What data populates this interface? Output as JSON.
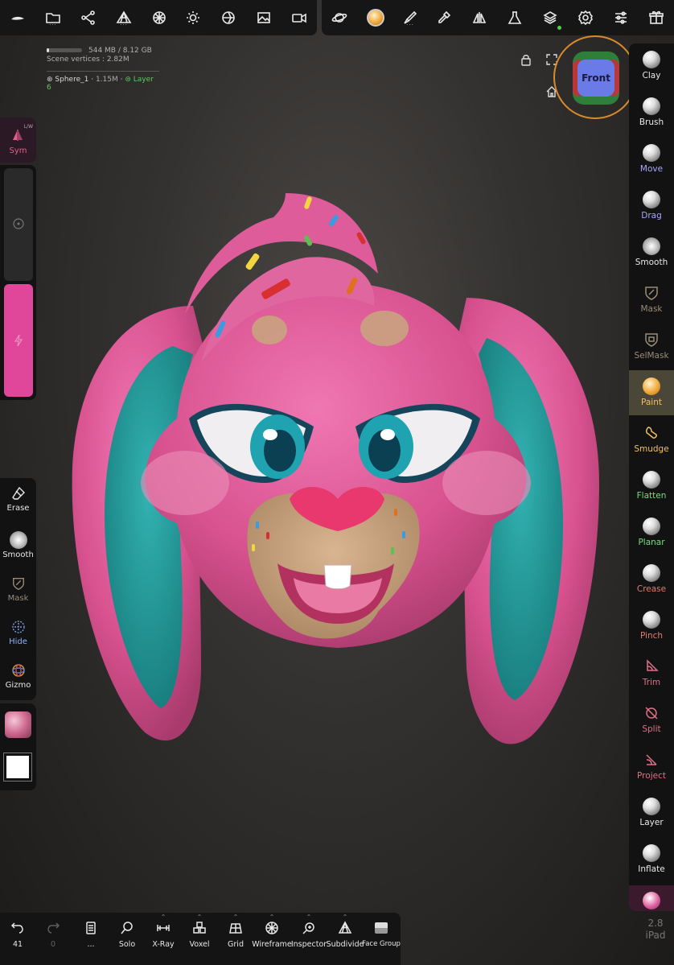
{
  "topbar_left": [
    {
      "icon": "nomad-logo-icon"
    },
    {
      "icon": "folder-icon",
      "dots": "..."
    },
    {
      "icon": "scene-tree-icon"
    },
    {
      "icon": "topology-icon",
      "dots": "..."
    },
    {
      "icon": "material-sphere-icon"
    },
    {
      "icon": "light-icon"
    },
    {
      "icon": "shading-icon"
    },
    {
      "icon": "background-image-icon"
    },
    {
      "icon": "camera-icon"
    }
  ],
  "topbar_right": [
    {
      "icon": "planet-icon"
    },
    {
      "icon": "paint-material-icon"
    },
    {
      "icon": "brush-stroke-icon",
      "dots": "..."
    },
    {
      "icon": "picker-icon"
    },
    {
      "icon": "symmetry-icon"
    },
    {
      "icon": "flask-icon"
    },
    {
      "icon": "layers-icon"
    },
    {
      "icon": "settings-gear-icon"
    },
    {
      "icon": "sliders-icon"
    },
    {
      "icon": "gift-icon"
    }
  ],
  "stats": {
    "memory": "544 MB / 8.12 GB",
    "memory_fraction": 0.067,
    "vertices": "Scene vertices : 2.82M"
  },
  "object": {
    "name": "Sphere_1",
    "verts": "1.15M",
    "layer": "Layer 6"
  },
  "gizmo": {
    "face_label": "Front"
  },
  "right_tools": [
    {
      "label": "Clay",
      "color": "#e8e8e8",
      "icon": "clay-ball-icon"
    },
    {
      "label": "Brush",
      "color": "#e8e8e8",
      "icon": "brush-ball-icon"
    },
    {
      "label": "Move",
      "color": "#a9a6ff",
      "icon": "move-ball-icon"
    },
    {
      "label": "Drag",
      "color": "#a9a6ff",
      "icon": "drag-ball-icon"
    },
    {
      "label": "Smooth",
      "color": "#e8e8e8",
      "icon": "smooth-icon"
    },
    {
      "label": "Mask",
      "color": "#9a8c78",
      "icon": "mask-icon"
    },
    {
      "label": "SelMask",
      "color": "#9a8c78",
      "icon": "selmask-icon"
    },
    {
      "label": "Paint",
      "color": "#f0c060",
      "icon": "paint-ball-icon",
      "active": true
    },
    {
      "label": "Smudge",
      "color": "#f0c060",
      "icon": "smudge-icon"
    },
    {
      "label": "Flatten",
      "color": "#6fe07c",
      "icon": "flatten-ball-icon"
    },
    {
      "label": "Planar",
      "color": "#6fe07c",
      "icon": "planar-ball-icon"
    },
    {
      "label": "Crease",
      "color": "#e07c6f",
      "icon": "crease-ball-icon"
    },
    {
      "label": "Pinch",
      "color": "#e07c6f",
      "icon": "pinch-ball-icon"
    },
    {
      "label": "Trim",
      "color": "#e06f88",
      "icon": "trim-icon"
    },
    {
      "label": "Split",
      "color": "#e06f88",
      "icon": "split-icon"
    },
    {
      "label": "Project",
      "color": "#e06f88",
      "icon": "project-icon"
    },
    {
      "label": "Layer",
      "color": "#e8e8e8",
      "icon": "layer-ball-icon"
    },
    {
      "label": "Inflate",
      "color": "#e8e8e8",
      "icon": "inflate-ball-icon"
    }
  ],
  "sym": {
    "label": "Sym",
    "lw": "L/W"
  },
  "sliders": {
    "radius_fraction": 0.12,
    "intensity_fraction": 1.0
  },
  "left_tools": [
    {
      "label": "Erase",
      "color": "#e8e8e8",
      "icon": "eraser-icon"
    },
    {
      "label": "Smooth",
      "color": "#e8e8e8",
      "icon": "smooth-icon"
    },
    {
      "label": "Mask",
      "color": "#9a8c78",
      "icon": "mask-icon"
    },
    {
      "label": "Hide",
      "color": "#8fb2ff",
      "icon": "hide-icon"
    },
    {
      "label": "Gizmo",
      "color": "#e8e8e8",
      "icon": "gizmo-icon"
    }
  ],
  "colors": {
    "paint": "#ffffff",
    "accent": "#e0479a"
  },
  "bottom_tools": [
    {
      "label": "41",
      "icon": "undo-icon"
    },
    {
      "label": "0",
      "icon": "redo-icon",
      "disabled": true
    },
    {
      "label": "...",
      "icon": "history-icon"
    },
    {
      "label": "Solo",
      "icon": "solo-icon"
    },
    {
      "label": "X-Ray",
      "icon": "xray-icon",
      "caret": true
    },
    {
      "label": "Voxel",
      "icon": "voxel-icon",
      "caret": true
    },
    {
      "label": "Grid",
      "icon": "grid-icon",
      "caret": true
    },
    {
      "label": "Wireframe",
      "icon": "wireframe-icon",
      "caret": true
    },
    {
      "label": "Inspector",
      "icon": "inspector-icon",
      "caret": true
    },
    {
      "label": "Subdivide",
      "icon": "subdivide-icon",
      "caret": true
    },
    {
      "label": "Face Group",
      "icon": "facegroup-icon"
    }
  ],
  "version": {
    "number": "2.8",
    "device": "iPad"
  }
}
